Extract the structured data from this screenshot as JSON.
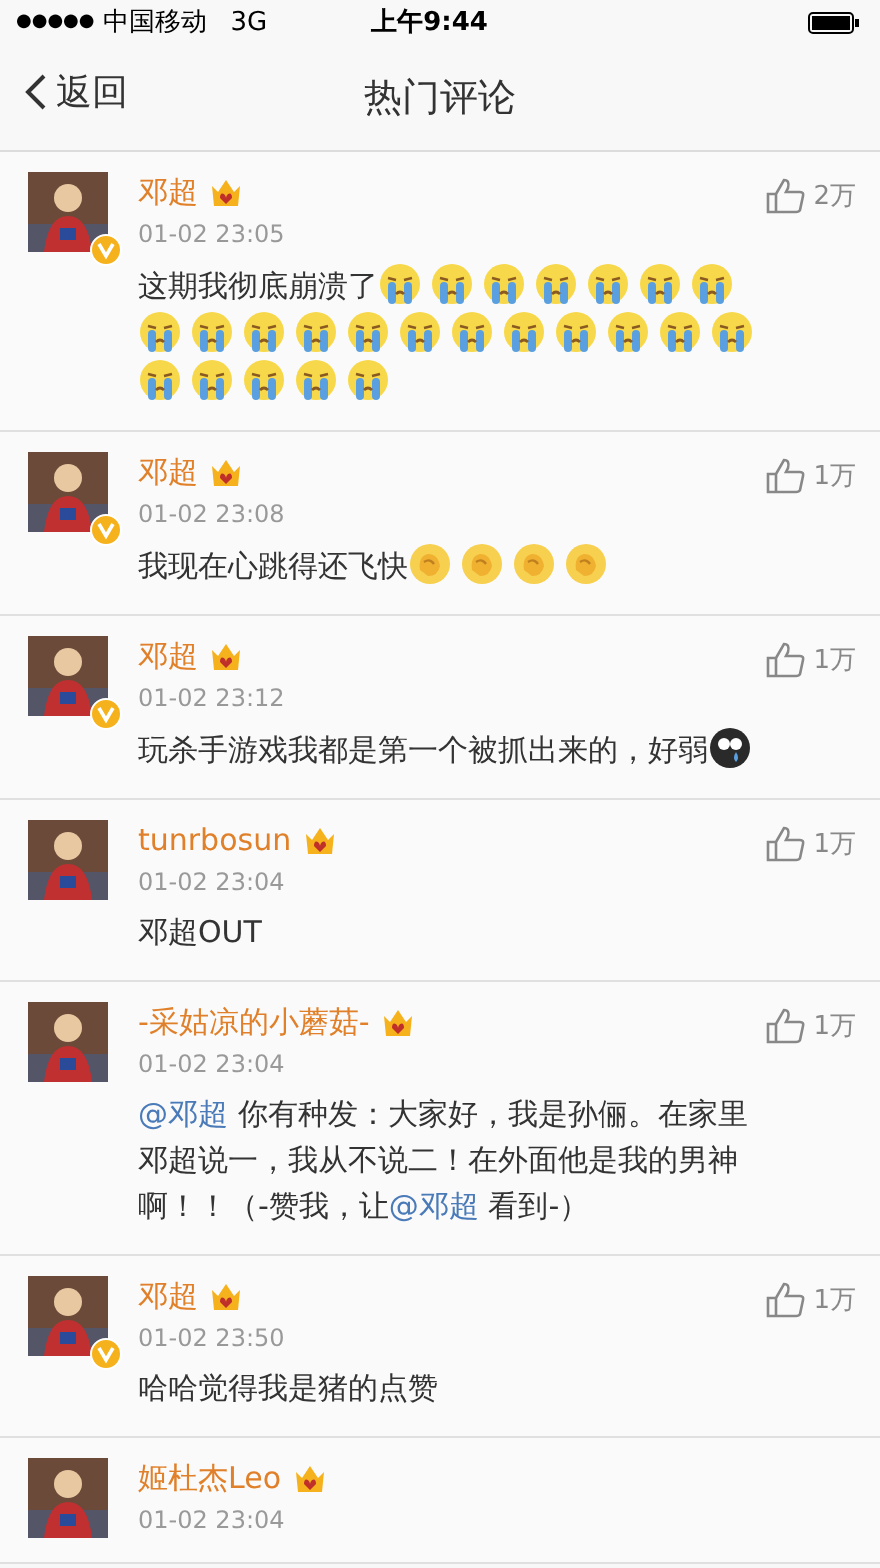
{
  "status_bar": {
    "signal_dots": "●●●●●",
    "carrier": "中国移动",
    "network": "3G",
    "time": "上午9:44"
  },
  "nav": {
    "back": "返回",
    "title": "热门评论"
  },
  "comments": [
    {
      "name": "邓超",
      "verified": true,
      "date": "01-02 23:05",
      "likes": "2万",
      "segments": [
        {
          "kind": "text",
          "text": "这期我彻底崩溃了"
        },
        {
          "kind": "cry"
        },
        {
          "kind": "cry"
        },
        {
          "kind": "cry"
        },
        {
          "kind": "cry"
        },
        {
          "kind": "cry"
        },
        {
          "kind": "cry"
        },
        {
          "kind": "cry"
        },
        {
          "kind": "cry"
        },
        {
          "kind": "cry"
        },
        {
          "kind": "cry"
        },
        {
          "kind": "cry"
        },
        {
          "kind": "cry"
        },
        {
          "kind": "cry"
        },
        {
          "kind": "cry"
        },
        {
          "kind": "cry"
        },
        {
          "kind": "cry"
        },
        {
          "kind": "cry"
        },
        {
          "kind": "cry"
        },
        {
          "kind": "cry"
        },
        {
          "kind": "cry"
        },
        {
          "kind": "cry"
        },
        {
          "kind": "cry"
        },
        {
          "kind": "cry"
        },
        {
          "kind": "cry"
        }
      ]
    },
    {
      "name": "邓超",
      "verified": true,
      "date": "01-02 23:08",
      "likes": "1万",
      "segments": [
        {
          "kind": "text",
          "text": "我现在心跳得还飞快"
        },
        {
          "kind": "clap"
        },
        {
          "kind": "clap"
        },
        {
          "kind": "clap"
        },
        {
          "kind": "clap"
        }
      ]
    },
    {
      "name": "邓超",
      "verified": true,
      "date": "01-02 23:12",
      "likes": "1万",
      "segments": [
        {
          "kind": "text",
          "text": "玩杀手游戏我都是第一个被抓出来的，好弱"
        },
        {
          "kind": "sob"
        }
      ]
    },
    {
      "name": "tunrbosun",
      "verified": false,
      "date": "01-02 23:04",
      "likes": "1万",
      "segments": [
        {
          "kind": "text",
          "text": "邓超OUT"
        }
      ]
    },
    {
      "name": "-采姑凉的小蘑菇-",
      "verified": false,
      "date": "01-02 23:04",
      "likes": "1万",
      "segments": [
        {
          "kind": "mention",
          "text": "@邓超"
        },
        {
          "kind": "text",
          "text": " 你有种发：大家好，我是孙俪。在家里邓超说一，我从不说二！在外面他是我的男神啊！！（-赞我，让"
        },
        {
          "kind": "mention",
          "text": "@邓超"
        },
        {
          "kind": "text",
          "text": " 看到-）"
        }
      ]
    },
    {
      "name": "邓超",
      "verified": true,
      "date": "01-02 23:50",
      "likes": "1万",
      "segments": [
        {
          "kind": "text",
          "text": "哈哈觉得我是猪的点赞"
        }
      ]
    },
    {
      "name": "姬杜杰Leo",
      "verified": false,
      "date": "01-02 23:04"
    }
  ]
}
